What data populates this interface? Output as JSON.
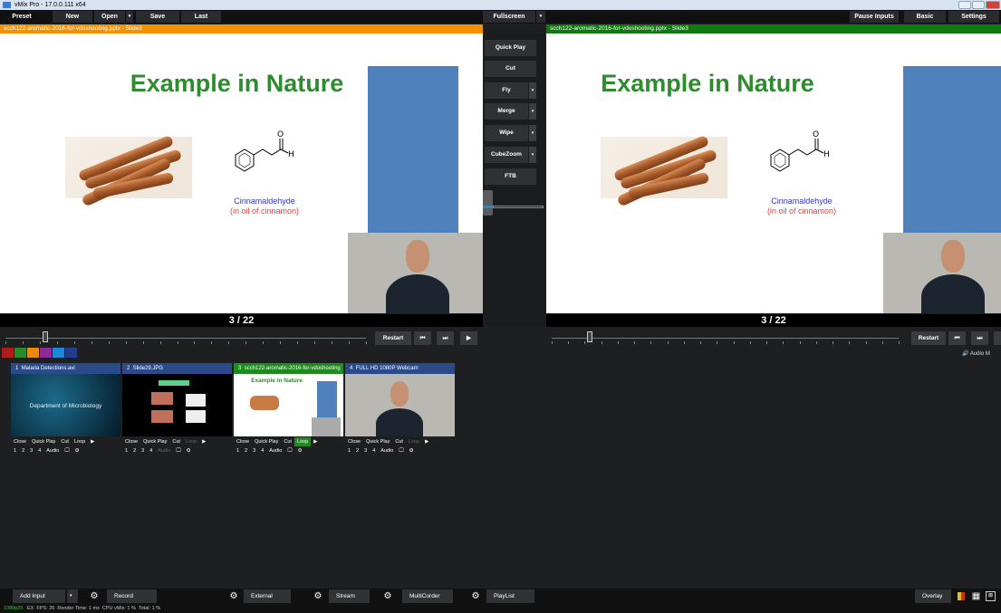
{
  "window": {
    "title": "vMix Pro - 17.0.0.111 x64"
  },
  "toolbar": {
    "preset": "Preset",
    "new": "New",
    "open": "Open",
    "save": "Save",
    "last": "Last",
    "fullscreen": "Fullscreen",
    "pause_inputs": "Pause Inputs",
    "basic": "Basic",
    "settings": "Settings"
  },
  "preview": {
    "label": "scch122-aromatic-2016-for-vdoshooting.pptx - Slide3",
    "label_color": "#f39200",
    "slide_title": "Example in Nature",
    "compound": "Cinnamaldehyde",
    "compound_note": "(in oil of cinnamon)",
    "page": "3 / 22",
    "restart": "Restart",
    "position": 0.11
  },
  "output": {
    "label": "scch122-aromatic-2016-for-vdoshooting.pptx - Slide3",
    "label_color": "#0f7a0f",
    "slide_title": "Example in Nature",
    "compound": "Cinnamaldehyde",
    "compound_note": "(in oil of cinnamon)",
    "page": "3 / 22",
    "restart": "Restart",
    "audio": "Audio M",
    "position": 0.11
  },
  "transitions": {
    "quick_play": "Quick Play",
    "cut": "Cut",
    "fly": "Fly",
    "merge": "Merge",
    "wipe": "Wipe",
    "cubezoom": "CubeZoom",
    "ftb": "FTB"
  },
  "swatches": [
    "#b01c1c",
    "#2a8a2a",
    "#e98a10",
    "#8e2a9a",
    "#1e8ad6",
    "#233d8a"
  ],
  "inputs": [
    {
      "number": "1",
      "name": "Malaria Detections.avi",
      "thumb_text": "Department of Microbiology",
      "controls": [
        "Close",
        "Quick Play",
        "Cut",
        "Loop"
      ],
      "nums": [
        "1",
        "2",
        "3",
        "4",
        "Audio"
      ]
    },
    {
      "number": "2",
      "name": "Slide29.JPG",
      "controls": [
        "Close",
        "Quick Play",
        "Cut",
        "Loop"
      ],
      "nums": [
        "1",
        "2",
        "3",
        "4",
        "Audio"
      ]
    },
    {
      "number": "3",
      "name": "scch122-aromatic-2016-for-vdoshooting",
      "thumb_text": "Example in Nature",
      "controls": [
        "Close",
        "Quick Play",
        "Cut",
        "Loop"
      ],
      "nums": [
        "1",
        "2",
        "3",
        "4",
        "Audio"
      ]
    },
    {
      "number": "4",
      "name": "FULL HD 1080P Webcam",
      "controls": [
        "Close",
        "Quick Play",
        "Cut",
        "Loop"
      ],
      "nums": [
        "1",
        "2",
        "3",
        "4",
        "Audio"
      ]
    }
  ],
  "bottombar": {
    "add_input": "Add Input",
    "record": "Record",
    "external": "External",
    "stream": "Stream",
    "multicorder": "MultiCorder",
    "playlist": "PlayList",
    "overlay": "Overlay"
  },
  "status": {
    "format": "1080p25",
    "ex": "EX",
    "fps_label": "FPS:",
    "fps": "26",
    "render_label": "Render Time:",
    "render": "1 ms",
    "cpu_label": "CPU vMix:",
    "cpu": "1 %",
    "total_label": "Total:",
    "total": "1 %"
  }
}
